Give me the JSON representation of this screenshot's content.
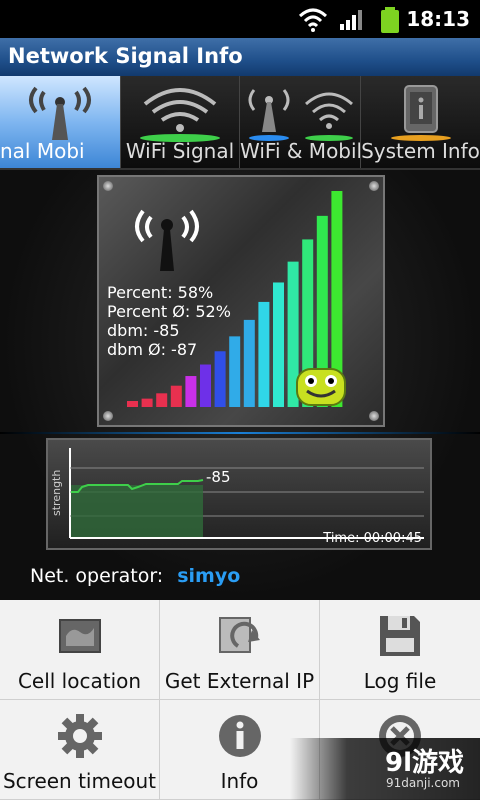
{
  "status": {
    "time": "18:13",
    "colors": {
      "battery": "#7ed321"
    }
  },
  "app": {
    "title": "Network Signal Info"
  },
  "tabs": [
    {
      "label": "nal       Mobi",
      "icon": "signal-tower-icon",
      "active": true
    },
    {
      "label": "WiFi Signal",
      "icon": "wifi-icon"
    },
    {
      "label": "WiFi & Mobil",
      "icon": "wifi-mobile-icon"
    },
    {
      "label": "System Info",
      "icon": "phone-info-icon"
    }
  ],
  "signal": {
    "percent": "Percent: 58%",
    "percent_avg": "Percent Ø: 52%",
    "dbm": "dbm: -85",
    "dbm_avg": "dbm Ø: -87",
    "level": 0.58
  },
  "graph": {
    "ylabel": "strength",
    "current": "-85",
    "time": "Time: 00:00:45"
  },
  "operator": {
    "label": "Net. operator:",
    "value": "simyo"
  },
  "menu": [
    {
      "label": "Cell location",
      "icon": "map-icon"
    },
    {
      "label": "Get External IP",
      "icon": "refresh-window-icon"
    },
    {
      "label": "Log file",
      "icon": "floppy-disk-icon"
    },
    {
      "label": "Screen timeout",
      "icon": "gear-icon"
    },
    {
      "label": "Info",
      "icon": "info-icon"
    },
    {
      "label": "",
      "icon": "close-icon"
    }
  ],
  "watermark": {
    "big": "9l游戏",
    "small": "91danji.com"
  }
}
